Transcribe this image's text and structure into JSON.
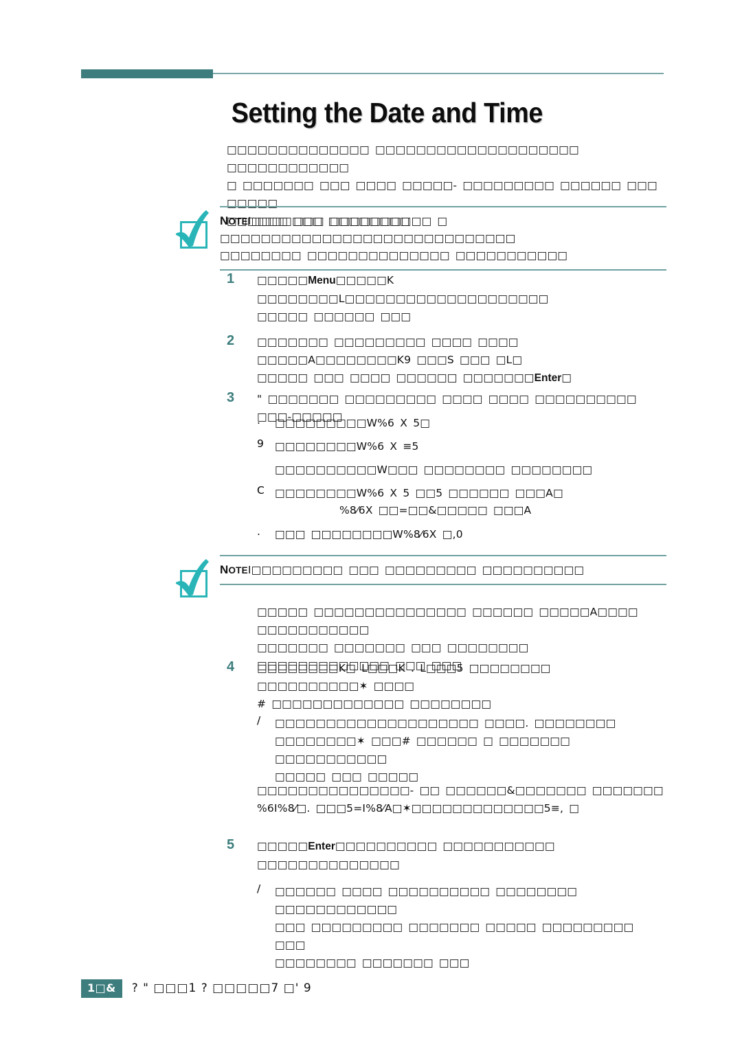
{
  "document": {
    "title": "Setting the Date and Time",
    "accent_color": "#3d7d7d",
    "rule_light_color": "#7aa8a8",
    "note_icon_color": "#29b5b8",
    "note_rule_color": "#6ea0a0"
  },
  "intro": {
    "line1": "□□□□□□□□□□□□□□ □□□□□□□□□□□□□□□□□□□□ □□□□□□□□□□□□",
    "line2": "□ □□□□□□□ □□□ □□□□ □□□□□- □□□□□□□□□ □□□□□□ □□□ □□□□□",
    "line3": "□□□□□□ □□□ □□□□□□□□□□ □"
  },
  "note1": {
    "label": "NOTE",
    "label_caps": "N",
    "label_small": "OTE",
    "separator": "I",
    "line1": "□□□□□□□ □□□□□□□□ □□□□□□□□□□□□□□□□□□□□□□□□□□□□□",
    "line2": "□□□□□□□□ □□□□□□□□□□□□□□ □□□□□□□□□□□"
  },
  "note2": {
    "label": "NOTE",
    "label_caps": "N",
    "label_small": "OTE",
    "separator": "I",
    "line1": "□□□□□□□□□ □□□ □□□□□□□□□ □□□□□□□□□□"
  },
  "steps": [
    {
      "number": "1",
      "lines": [
        {
          "parts": [
            {
              "t": "□□□□□",
              "bold": false
            },
            {
              "t": "Menu",
              "bold": true
            },
            {
              "t": "□□□□□K",
              "bold": false
            },
            {
              "t": "□□□□□□□□L□□□□□□□□□□□□□□□□□□□□",
              "bold": false
            }
          ]
        },
        {
          "parts": [
            {
              "t": "□□□□□ □□□□□□ □□□",
              "bold": false
            }
          ]
        }
      ]
    },
    {
      "number": "2",
      "lines": [
        {
          "parts": [
            {
              "t": "□□□□□□□ □□□□□□□□□ □□□□ □□□□ □□□□□A□□□□□□□□K9 □□□S □□□ □L□",
              "bold": false
            }
          ]
        },
        {
          "parts": [
            {
              "t": "□□□□□ □□□ □□□□ □□□□□□ □□□□□□□",
              "bold": false
            },
            {
              "t": "Enter",
              "bold": true
            },
            {
              "t": "□",
              "bold": false
            }
          ]
        }
      ]
    },
    {
      "number": "3",
      "lines": [
        {
          "parts": [
            {
              "t": "\" □□□□□□□ □□□□□□□□□ □□□□ □□□□ □□□□□□□□□□ □□□-□□□□□",
              "bold": false
            }
          ]
        }
      ]
    }
  ],
  "step3_list": [
    {
      "marker": ".",
      "text": "□□□□□□□□□W%6 X 5□"
    },
    {
      "marker": "9",
      "text": "□□□□□□□□W%6 X ≡5"
    },
    {
      "marker": "",
      "text": "□□□□□□□□□□W□□□ □□□□□□□□ □□□□□□□□"
    },
    {
      "marker": "C",
      "text": "□□□□□□□□W%6 X 5 □□5 □□□□□□ □□□A□"
    },
    {
      "marker": "",
      "text": "%8⁄6X □□=□□&□□□□□ □□□A",
      "indent": true
    },
    {
      "marker": ".",
      "text": "□□□ □□□□□□□□W%8⁄6X □,0"
    }
  ],
  "note2_followup": {
    "line1": "□□□□□ □□□□□□□□□□□□□□□ □□□□□□ □□□□□A□□□□ □□□□□□□□□□□",
    "line2": "□□□□□□□ □□□□□□□ □□□ □□□□□□□□ □□□□□□□□□□□□□ □□□ □□□"
  },
  "step4": {
    "number": "4",
    "line1": "□□□□□□□□K□ L□□□K . L□□□5 □□□□□□□□ □□□□□□□□□□✶ □□□□",
    "line2": "# □□□□□□□□□□□□□ □□□□□□□□"
  },
  "step4_note": {
    "marker": "/",
    "line1": "□□□□□□□□□□□□□□□□□□□□  □□□□. □□□□□□□□",
    "line2": "□□□□□□□□✶ □□□# □□□□□□ □ □□□□□□□ □□□□□□□□□□□",
    "line3": "□□□□□ □□□ □□□□□"
  },
  "step4_para": {
    "line1": "□□□□□□□□□□□□□□□- □□ □□□□□□&□□□□□□□ □□□□□□□",
    "line2": "%6I%8⁄□. □□□5=I%8⁄A□✶□□□□□□□□□□□□□5≡, □"
  },
  "step5": {
    "number": "5",
    "prefix": "□□□□□",
    "bold_word": "Enter",
    "suffix": "□□□□□□□□□□ □□□□□□□□□□□ □□□□□□□□□□□□□□"
  },
  "step5_note": {
    "marker": "/",
    "line1": "□□□□□□ □□□□ □□□□□□□□□□ □□□□□□□□ □□□□□□□□□□□□",
    "line2": "□□□ □□□□□□□□□ □□□□□□□ □□□□□ □□□□□□□□□ □□□",
    "line3": "□□□□□□□□ □□□□□□□ □□□"
  },
  "footer": {
    "badge": "1□&",
    "badge_number": "1",
    "text": "? \" □□□1 ? □□□□□7 □' 9"
  }
}
